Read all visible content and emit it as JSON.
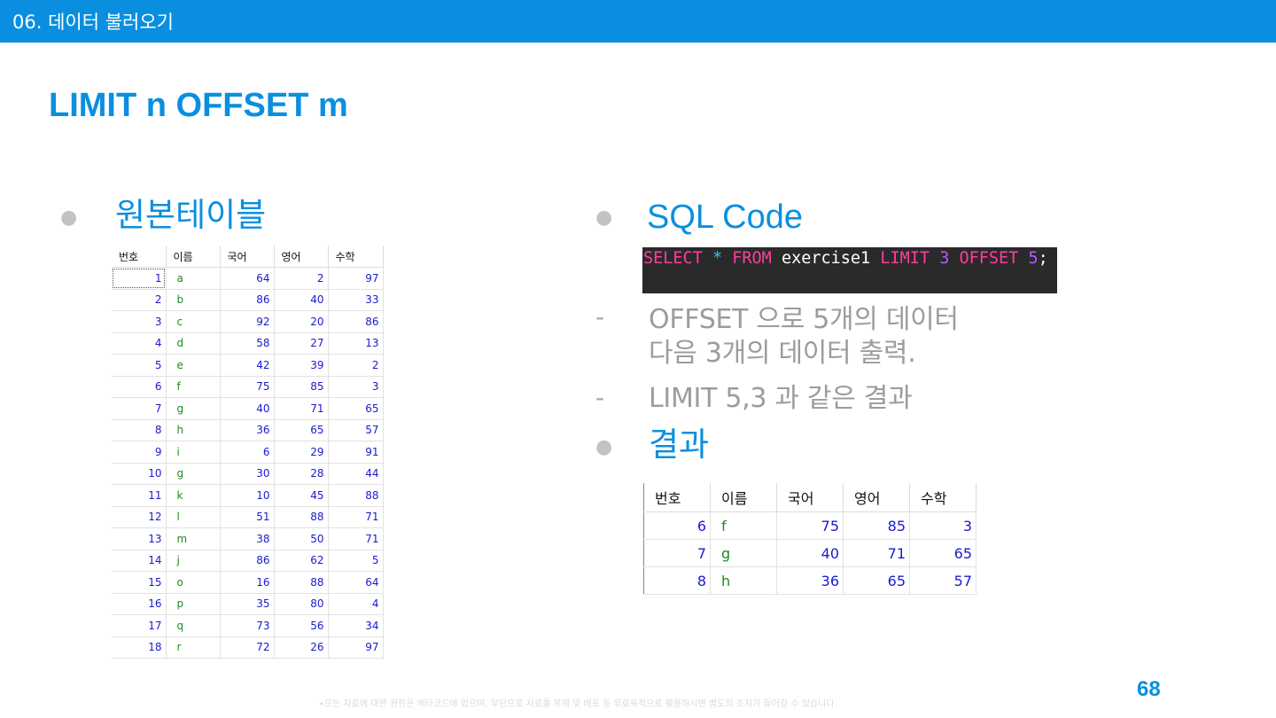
{
  "header": {
    "section_title": "06. 데이터 불러오기"
  },
  "slide": {
    "title": "LIMIT n OFFSET m",
    "page_number": "68"
  },
  "left": {
    "heading": "원본테이블",
    "table": {
      "columns": [
        "번호",
        "이름",
        "국어",
        "영어",
        "수학"
      ],
      "rows": [
        [
          "1",
          "a",
          "64",
          "2",
          "97"
        ],
        [
          "2",
          "b",
          "86",
          "40",
          "33"
        ],
        [
          "3",
          "c",
          "92",
          "20",
          "86"
        ],
        [
          "4",
          "d",
          "58",
          "27",
          "13"
        ],
        [
          "5",
          "e",
          "42",
          "39",
          "2"
        ],
        [
          "6",
          "f",
          "75",
          "85",
          "3"
        ],
        [
          "7",
          "g",
          "40",
          "71",
          "65"
        ],
        [
          "8",
          "h",
          "36",
          "65",
          "57"
        ],
        [
          "9",
          "i",
          "6",
          "29",
          "91"
        ],
        [
          "10",
          "g",
          "30",
          "28",
          "44"
        ],
        [
          "11",
          "k",
          "10",
          "45",
          "88"
        ],
        [
          "12",
          "l",
          "51",
          "88",
          "71"
        ],
        [
          "13",
          "m",
          "38",
          "50",
          "71"
        ],
        [
          "14",
          "j",
          "86",
          "62",
          "5"
        ],
        [
          "15",
          "o",
          "16",
          "88",
          "64"
        ],
        [
          "16",
          "p",
          "35",
          "80",
          "4"
        ],
        [
          "17",
          "q",
          "73",
          "56",
          "34"
        ],
        [
          "18",
          "r",
          "72",
          "26",
          "97"
        ]
      ]
    }
  },
  "right": {
    "sql_heading": "SQL Code",
    "code": {
      "select": "SELECT",
      "star": "*",
      "from": "FROM",
      "table": "exercise1",
      "limit": "LIMIT",
      "limit_value": "3",
      "offset": "OFFSET",
      "offset_value": "5",
      "terminator": ";"
    },
    "notes": [
      "OFFSET 으로 5개의 데이터\n다음 3개의 데이터 출력.",
      "LIMIT 5,3 과 같은 결과"
    ],
    "result_heading": "결과",
    "result_table": {
      "columns": [
        "번호",
        "이름",
        "국어",
        "영어",
        "수학"
      ],
      "rows": [
        [
          "6",
          "f",
          "75",
          "85",
          "3"
        ],
        [
          "7",
          "g",
          "40",
          "71",
          "65"
        ],
        [
          "8",
          "h",
          "36",
          "65",
          "57"
        ]
      ]
    }
  },
  "footer": {
    "note": "•모든 자료에 대한 권한은 메타코드에 있으며, 무단으로 자료를 복제 및 배포 등 유료목적으로 활용하시면 별도의 조치가 들어갈 수 있습니다."
  }
}
